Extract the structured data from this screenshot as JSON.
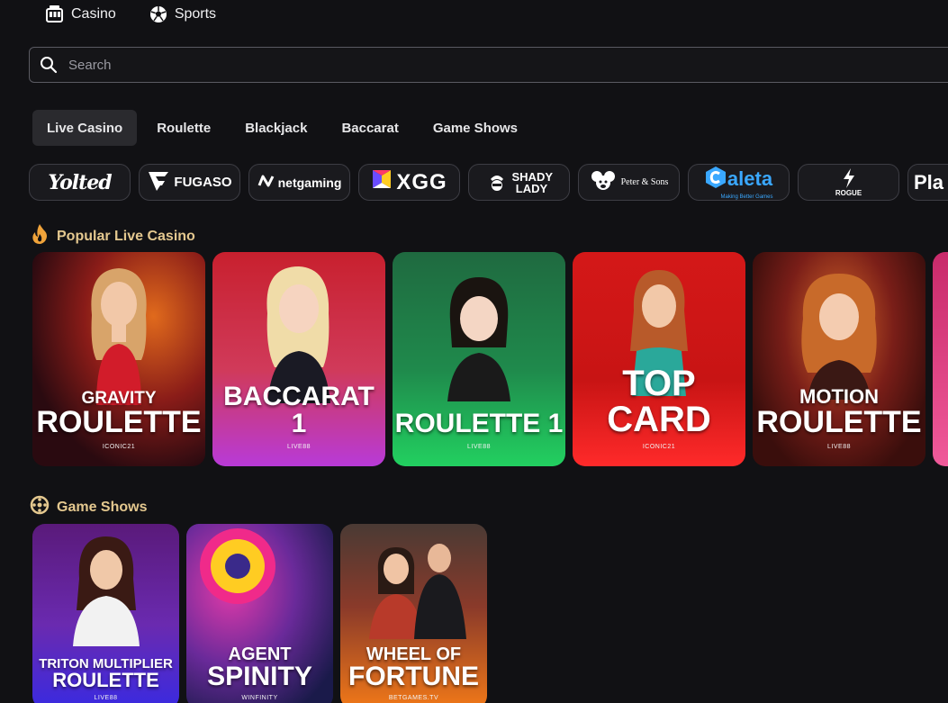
{
  "nav": {
    "items": [
      {
        "label": "Casino",
        "icon": "slot-machine-icon"
      },
      {
        "label": "Sports",
        "icon": "soccer-ball-icon"
      }
    ]
  },
  "search": {
    "placeholder": "Search",
    "value": ""
  },
  "tabs": [
    {
      "label": "Live Casino",
      "active": true
    },
    {
      "label": "Roulette",
      "active": false
    },
    {
      "label": "Blackjack",
      "active": false
    },
    {
      "label": "Baccarat",
      "active": false
    },
    {
      "label": "Game Shows",
      "active": false
    }
  ],
  "providers": [
    {
      "name": "Yolted",
      "text": "Yolted"
    },
    {
      "name": "Fugaso",
      "text": "FUGASO"
    },
    {
      "name": "Netgaming",
      "text": "netgaming"
    },
    {
      "name": "XGG",
      "text": "XGG"
    },
    {
      "name": "Shady Lady",
      "text": "SHADY LADY"
    },
    {
      "name": "Peter & Sons",
      "text": "Peter & Sons"
    },
    {
      "name": "Caleta",
      "text": "aleta",
      "tagline": "Making Better Games"
    },
    {
      "name": "Rogue",
      "text": "ROGUE"
    },
    {
      "name": "Pla",
      "text": "Pla"
    }
  ],
  "sections": {
    "popular": {
      "title": "Popular Live Casino",
      "icon": "flame-icon",
      "games": [
        {
          "line1": "GRAVITY",
          "line2": "ROULETTE",
          "provider": "ICONIC21",
          "colors": [
            "#3a0a14",
            "#c41c28"
          ]
        },
        {
          "line1": "BACCARAT 1",
          "line2": "",
          "provider": "LIVE88",
          "colors": [
            "#c8202e",
            "#b83ad8"
          ]
        },
        {
          "line1": "ROULETTE 1",
          "line2": "",
          "provider": "LIVE88",
          "colors": [
            "#1f7a44",
            "#22d060"
          ]
        },
        {
          "line1": "TOP CARD",
          "line2": "",
          "provider": "ICONIC21",
          "colors": [
            "#d41818",
            "#ff2a2a"
          ]
        },
        {
          "line1": "MOTION",
          "line2": "ROULETTE",
          "provider": "LIVE88",
          "colors": [
            "#5a1a14",
            "#c02a1e"
          ]
        }
      ]
    },
    "gameshows": {
      "title": "Game Shows",
      "icon": "wheel-icon",
      "games": [
        {
          "line1": "TRITON MULTIPLIER",
          "line2": "ROULETTE",
          "provider": "LIVE88",
          "colors": [
            "#5a1a7a",
            "#3a2ae0"
          ]
        },
        {
          "line1": "AGENT",
          "line2": "SPINITY",
          "provider": "WINFINITY",
          "colors": [
            "#2a2a6a",
            "#c02ab8"
          ]
        },
        {
          "line1": "WHEEL OF",
          "line2": "FORTUNE",
          "provider": "BETGAMES.TV",
          "colors": [
            "#3a2a2a",
            "#f07818"
          ]
        }
      ]
    }
  }
}
